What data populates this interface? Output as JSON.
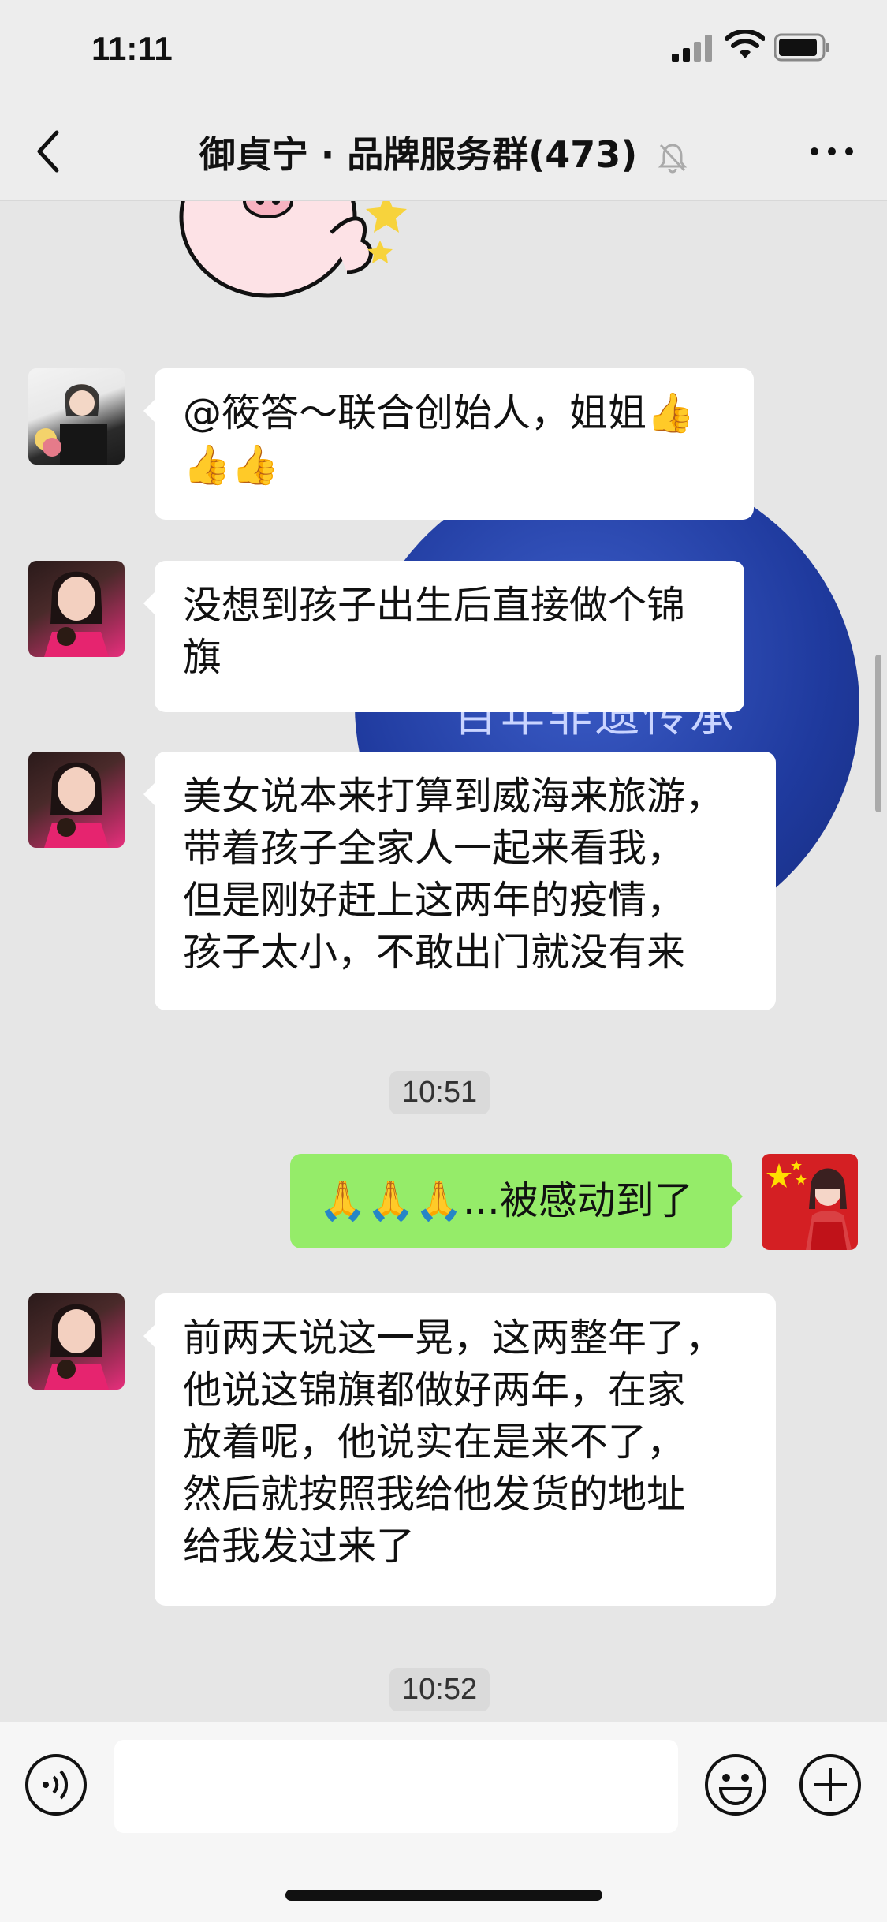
{
  "status_bar": {
    "time": "11:11"
  },
  "nav": {
    "title": "御貞宁 · 品牌服务群(473)"
  },
  "background_poster": {
    "text": "百年非遗传承"
  },
  "messages": [
    {
      "text": "@筱答～联合创始人，姐姐👍👍👍",
      "line1": "@筱答～联合创始人，姐姐👍",
      "line2": "👍👍"
    },
    {
      "line1": "没想到孩子出生后直接做个锦",
      "line2": "旗"
    },
    {
      "line1": "美女说本来打算到威海来旅游，",
      "line2": "带着孩子全家人一起来看我，",
      "line3": "但是刚好赶上这两年的疫情，",
      "line4": "孩子太小，不敢出门就没有来"
    },
    {
      "text": "🙏🙏🙏...被感动到了"
    },
    {
      "line1": "前两天说这一晃，这两整年了，",
      "line2": "他说这锦旗都做好两年，在家",
      "line3": "放着呢，他说实在是来不了，",
      "line4": "然后就按照我给他发货的地址",
      "line5": "给我发过来了"
    }
  ],
  "timestamps": [
    "10:51",
    "10:52"
  ],
  "input": {
    "placeholder": ""
  },
  "icons": [
    "back-icon",
    "mute-icon",
    "more-icon",
    "voice-icon",
    "emoji-icon",
    "add-icon"
  ],
  "colors": {
    "my_bubble": "#95ec69",
    "their_bubble": "#ffffff",
    "background": "#ededed"
  }
}
